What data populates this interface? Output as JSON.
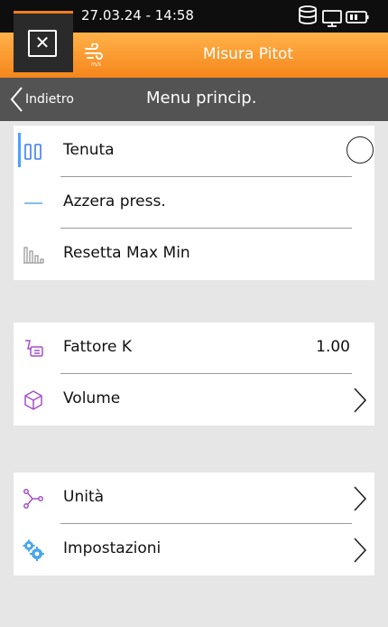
{
  "status": {
    "datetime": "27.03.24 - 14:58"
  },
  "header": {
    "close_symbol": "✕",
    "title": "Misura Pitot",
    "accent": "#f5861a"
  },
  "nav": {
    "back_label": "Indietro",
    "title": "Menu princip."
  },
  "groups": [
    {
      "items": [
        {
          "label": "Tenuta",
          "icon": "columns-icon",
          "control": "radio"
        },
        {
          "label": "Azzera press.",
          "icon": "dash-icon"
        },
        {
          "label": "Resetta Max Min",
          "icon": "bars-icon"
        }
      ]
    },
    {
      "items": [
        {
          "label": "Fattore K",
          "icon": "k-factor-icon",
          "value": "1.00"
        },
        {
          "label": "Volume",
          "icon": "cube-icon",
          "control": "chevron"
        }
      ]
    },
    {
      "items": [
        {
          "label": "Unità",
          "icon": "units-icon",
          "control": "chevron"
        },
        {
          "label": "Impostazioni",
          "icon": "gears-icon",
          "control": "chevron"
        }
      ]
    }
  ]
}
